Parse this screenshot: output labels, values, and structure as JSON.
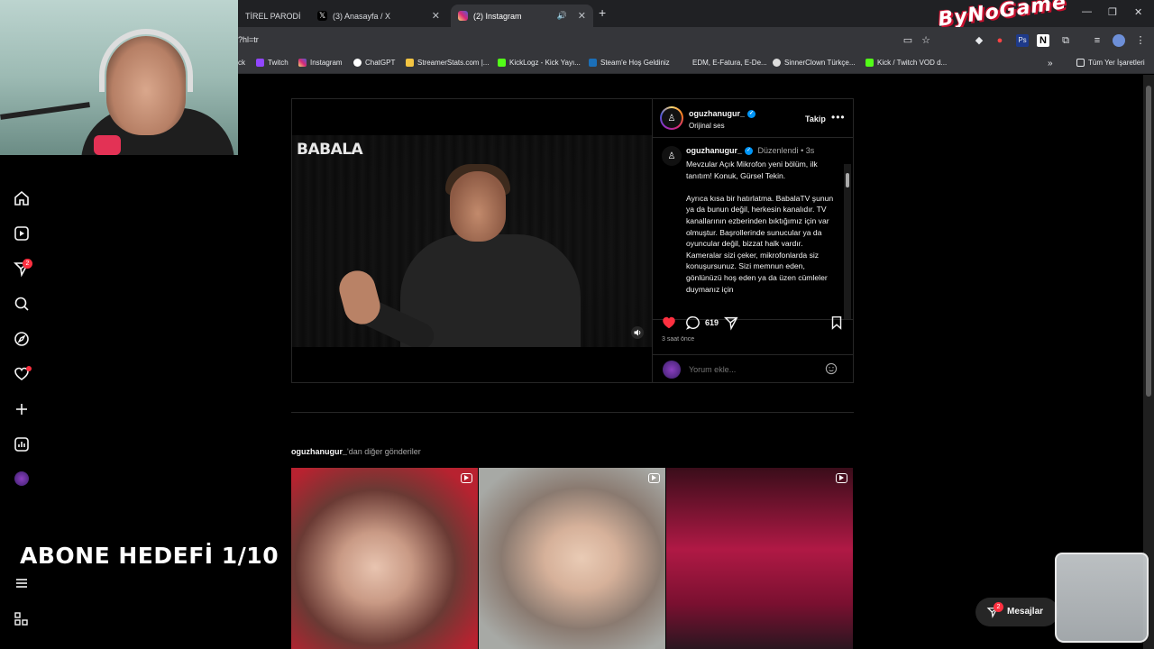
{
  "browser": {
    "tabs": [
      {
        "label": "TİREL PARODİ",
        "favicon_color": "#ff0000"
      },
      {
        "label": "(3) Anasayfa / X",
        "favicon_color": "#000000"
      },
      {
        "label": "(2) Instagram",
        "favicon_color": "#e1306c",
        "active": true
      }
    ],
    "url": "?hl=tr",
    "bookmarks": [
      {
        "label": "ck",
        "color": "#888888"
      },
      {
        "label": "Twitch",
        "color": "#9146ff"
      },
      {
        "label": "Instagram",
        "color": "#e1306c"
      },
      {
        "label": "ChatGPT",
        "color": "#ffffff"
      },
      {
        "label": "StreamerStats.com |...",
        "color": "#f4c542"
      },
      {
        "label": "KickLogz - Kick Yayı...",
        "color": "#53fc18"
      },
      {
        "label": "Steam'e Hoş Geldiniz",
        "color": "#1b2838"
      },
      {
        "label": "EDM, E-Fatura, E-De...",
        "color": "#333333"
      },
      {
        "label": "SinnerClown Türkçe...",
        "color": "#dddddd"
      },
      {
        "label": "Kick / Twitch VOD d...",
        "color": "#53fc18"
      }
    ],
    "all_bookmarks": "Tüm Yer İşaretleri",
    "logo": "ByNoGame"
  },
  "sidebar": {
    "icons": [
      "home-icon",
      "reels-icon",
      "direct-icon",
      "search-icon",
      "explore-icon",
      "notifications-icon",
      "create-icon",
      "dashboard-icon",
      "profile-icon",
      "menu-icon",
      "more-icon"
    ],
    "direct_badge": "2"
  },
  "post": {
    "username": "oguzhanugur_",
    "audio": "Orijinal ses",
    "follow": "Takip",
    "more": "•••",
    "caption_author": "oguzhanugur_",
    "edited": "Düzenlendi",
    "caption_time": "3s",
    "caption": "Mevzular Açık Mikrofon yeni bölüm, ilk tanıtım! Konuk, Gürsel Tekin.\n\nAyrıca kısa bir hatırlatma. BabalaTV şunun ya da bunun değil, herkesin kanalıdır. TV kanallarının ezberinden bıktığımız için var olmuştur. Başrollerinde sunucular ya da oyuncular değil, bizzat halk vardır. Kameralar sizi çeker, mikrofonlarda siz konuşursunuz. Sizi memnun eden, gönlünüzü hoş eden ya da üzen cümleler duymanız için",
    "video_logo": "BABALA",
    "comment_count": "619",
    "time_ago": "3 saat önce",
    "comment_placeholder": "Yorum ekle..."
  },
  "more_posts": {
    "username": "oguzhanugur_",
    "suffix": "'dan diğer gönderiler"
  },
  "overlay": {
    "goal_text": "ABONE HEDEFİ 1/10"
  },
  "messages": {
    "label": "Mesajlar",
    "badge": "2"
  },
  "colors": {
    "like": "#ff3040",
    "verified": "#0095f6",
    "bg": "#000000"
  }
}
